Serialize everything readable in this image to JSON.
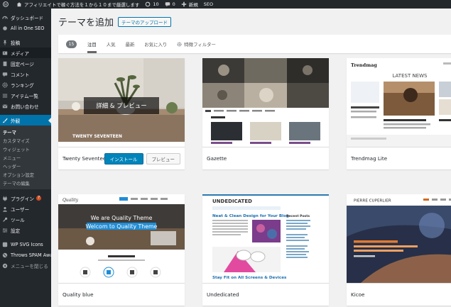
{
  "adminbar": {
    "site_name": "アフィリエイトで稼ぐ方法を１から１０まで厳選します",
    "updates": "10",
    "comments": "0",
    "new_label": "新規",
    "seo_label": "SEO"
  },
  "sidebar": {
    "items": [
      {
        "label": "ダッシュボード",
        "icon": "dashboard-icon"
      },
      {
        "label": "All in One SEO",
        "icon": "seo-icon"
      },
      {
        "label": "投稿",
        "icon": "pin-icon"
      },
      {
        "label": "メディア",
        "icon": "media-icon"
      },
      {
        "label": "固定ページ",
        "icon": "page-icon"
      },
      {
        "label": "コメント",
        "icon": "comment-icon"
      },
      {
        "label": "ランキング",
        "icon": "gear-icon"
      },
      {
        "label": "アイテム一覧",
        "icon": "list-icon"
      },
      {
        "label": "お問い合わせ",
        "icon": "mail-icon"
      },
      {
        "label": "外観",
        "icon": "brush-icon"
      }
    ],
    "submenu": [
      "テーマ",
      "カスタマイズ",
      "ウィジェット",
      "メニュー",
      "ヘッダー",
      "オプション設定",
      "テーマの編集"
    ],
    "lower_items": [
      {
        "label": "プラグイン",
        "badge": "7",
        "icon": "plugin-icon"
      },
      {
        "label": "ユーザー",
        "icon": "user-icon"
      },
      {
        "label": "ツール",
        "icon": "tool-icon"
      },
      {
        "label": "設定",
        "icon": "settings-icon"
      },
      {
        "label": "WP SVG Icons",
        "icon": "svg-icon"
      },
      {
        "label": "Throws SPAM Away",
        "icon": "spam-icon"
      },
      {
        "label": "メニューを閉じる",
        "icon": "collapse-icon"
      }
    ]
  },
  "header": {
    "title": "テーマを追加",
    "upload_label": "テーマのアップロード"
  },
  "filter": {
    "count": "15",
    "tabs": [
      "注目",
      "人気",
      "最新",
      "お気に入り"
    ],
    "feature_filter": "特徴フィルター"
  },
  "themes": [
    {
      "name": "Twenty Seventeen",
      "install": "インストール",
      "preview": "プレビュー",
      "overlay": "詳細 & プレビュー",
      "banner": "TWENTY SEVENTEEN"
    },
    {
      "name": "Gazette"
    },
    {
      "name": "Trendmag Lite",
      "logo": "Trendmag",
      "heading": "LATEST NEWS"
    },
    {
      "name": "Quality blue",
      "logo": "Quality",
      "hero1": "We are Quality Theme",
      "hero2": "Welcom to Quality Theme"
    },
    {
      "name": "Undedicated",
      "logo": "UNDEDICATED",
      "post1": "Neat & Clean Design for Your Blog",
      "post2": "Stay Fit on All Screens & Devices",
      "sidebar_head": "Recent Posts"
    },
    {
      "name": "Kicoe",
      "logo": "PIERRE CUPERLIER"
    }
  ]
}
